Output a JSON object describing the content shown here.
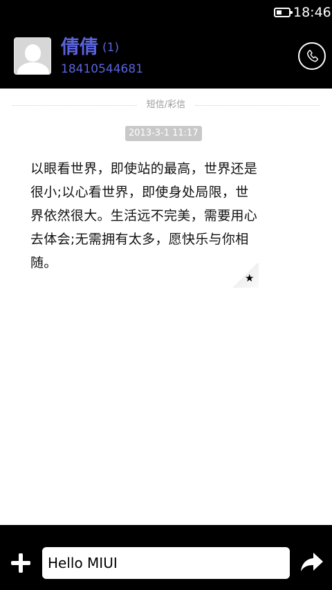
{
  "status_bar": {
    "time": "18:46",
    "battery_icon": "battery-icon"
  },
  "header": {
    "avatar_icon": "default-avatar-icon",
    "contact_name": "倩倩",
    "message_count": "(1)",
    "phone_number": "18410544681",
    "call_icon": "phone-icon"
  },
  "conversation": {
    "message_type_label": "短信/彩信",
    "messages": [
      {
        "timestamp": "2013-3-1 11:17",
        "text": "以眼看世界，即使站的最高，世界还是很小;以心看世界，即使身处局限，世界依然很大。生活远不完美，需要用心去体会;无需拥有太多，愿快乐与你相随。",
        "starred": true
      }
    ],
    "star_icon": "★"
  },
  "composer": {
    "add_icon": "plus-icon",
    "input_value": "Hello MIUI",
    "send_icon": "send-arrow-icon"
  },
  "colors": {
    "accent": "#5a63e0",
    "background": "#000000",
    "bubble": "#ffffff"
  }
}
